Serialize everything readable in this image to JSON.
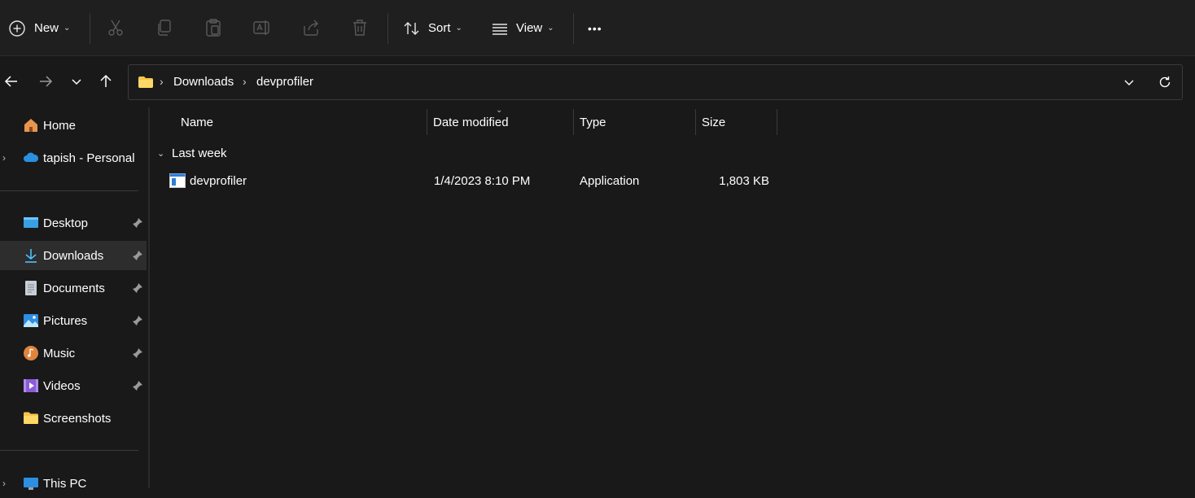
{
  "toolbar": {
    "new_label": "New",
    "sort_label": "Sort",
    "view_label": "View",
    "more_label": "•••"
  },
  "address": {
    "crumbs": [
      "Downloads",
      "devprofiler"
    ]
  },
  "sidebar": {
    "items": [
      {
        "label": "Home"
      },
      {
        "label": "tapish - Personal"
      },
      {
        "label": "Desktop"
      },
      {
        "label": "Downloads"
      },
      {
        "label": "Documents"
      },
      {
        "label": "Pictures"
      },
      {
        "label": "Music"
      },
      {
        "label": "Videos"
      },
      {
        "label": "Screenshots"
      },
      {
        "label": "This PC"
      }
    ]
  },
  "columns": {
    "name": "Name",
    "date": "Date modified",
    "type": "Type",
    "size": "Size"
  },
  "groups": [
    {
      "label": "Last week",
      "files": [
        {
          "name": "devprofiler",
          "date": "1/4/2023 8:10 PM",
          "type": "Application",
          "size": "1,803 KB"
        }
      ]
    }
  ],
  "colors": {
    "background": "#191919",
    "toolbar": "#1f1f1f",
    "selected": "#2d2d2d",
    "accent": "#4cc2ff",
    "folder": "#f7c548"
  }
}
